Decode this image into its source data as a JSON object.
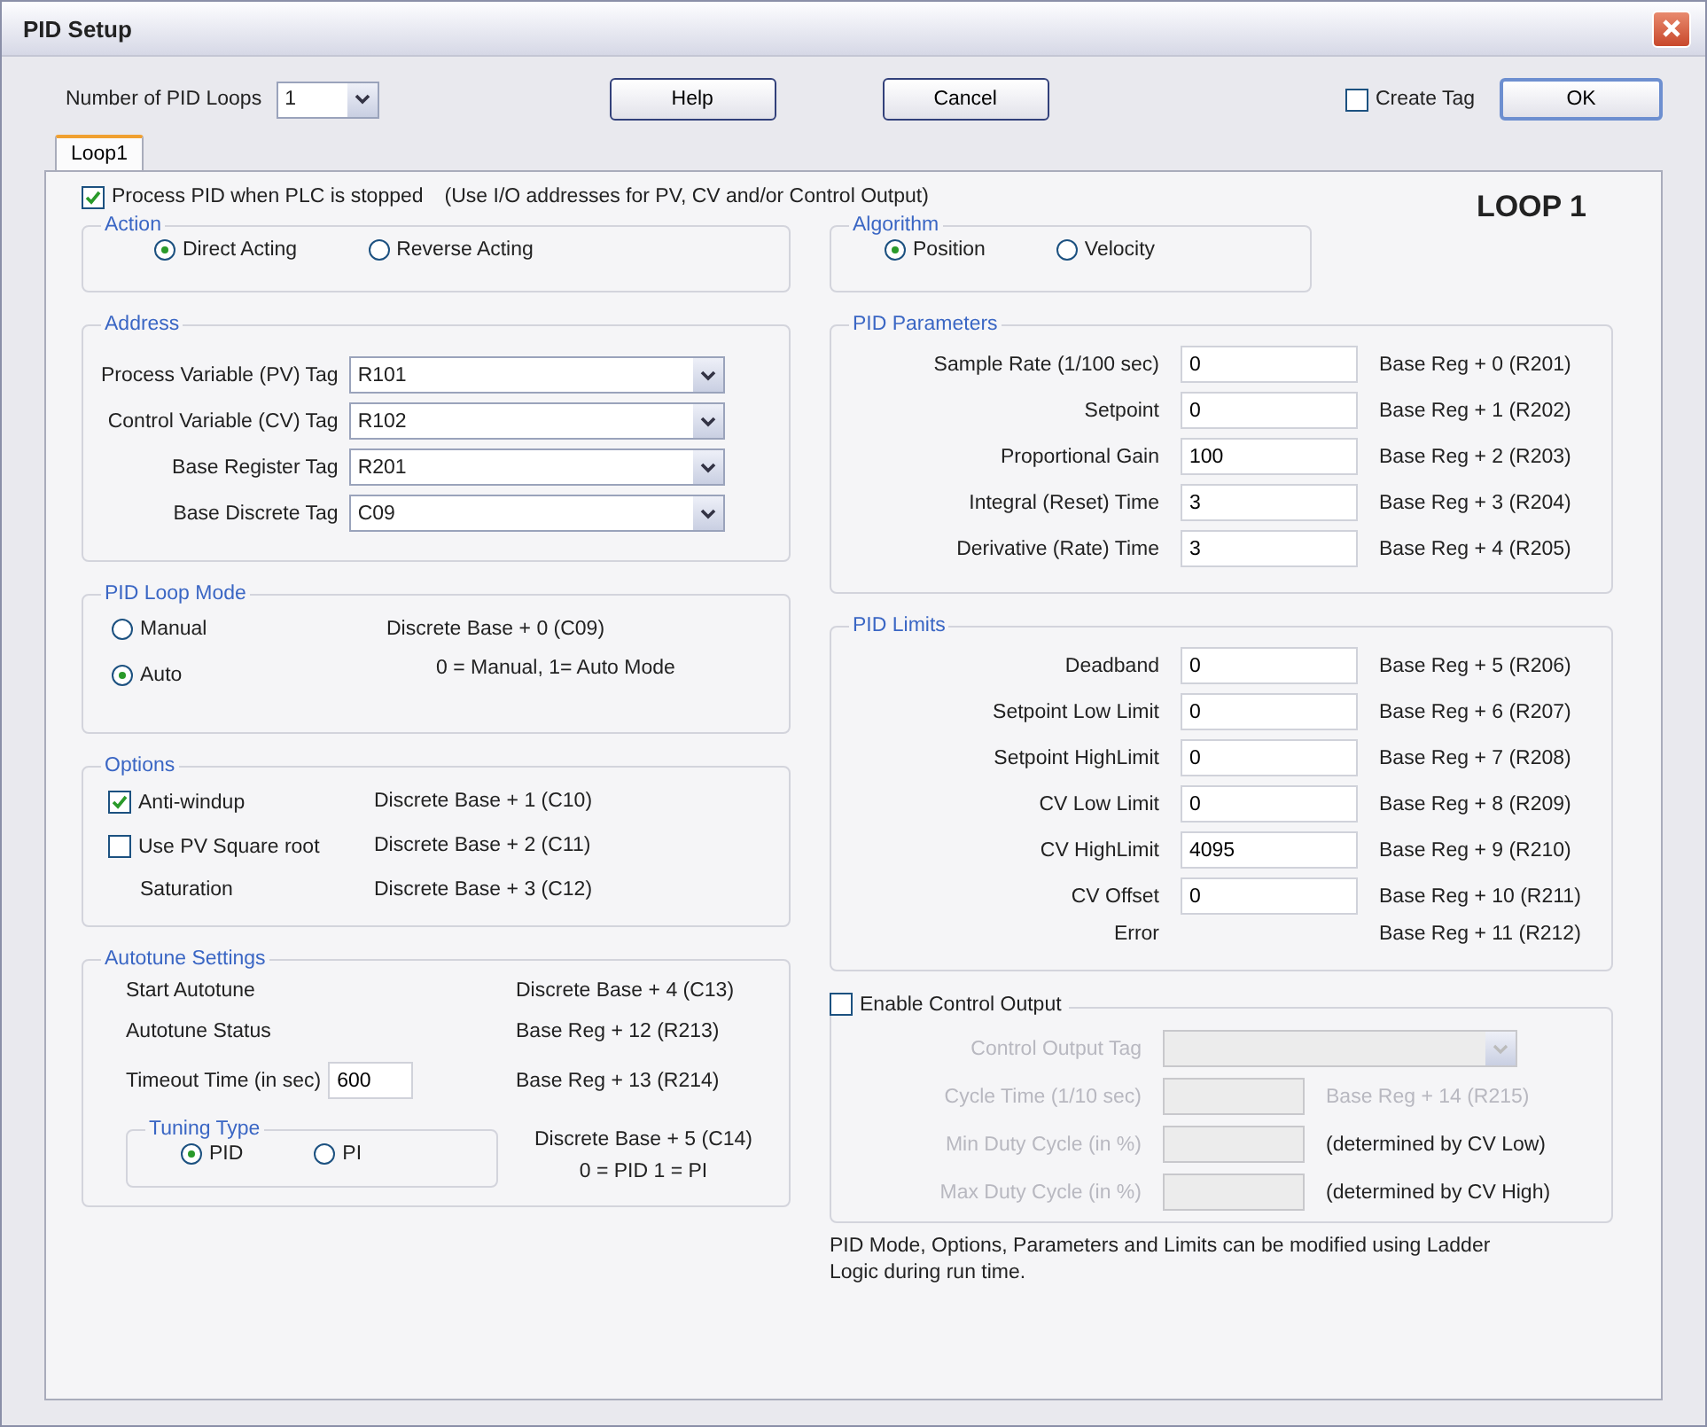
{
  "window": {
    "title": "PID Setup"
  },
  "header": {
    "loops_label": "Number of PID Loops",
    "loops_value": "1",
    "buttons": [
      "Help",
      "Cancel"
    ],
    "create_tag": {
      "label": "Create Tag",
      "checked": false
    },
    "ok": "OK"
  },
  "tabs": [
    {
      "label": "Loop1",
      "selected": true
    }
  ],
  "process_pid": {
    "label": "Process PID when PLC is stopped",
    "checked": true,
    "note": "(Use I/O addresses for PV, CV and/or Control Output)"
  },
  "loop_title": "LOOP 1",
  "action": {
    "title": "Action",
    "options": [
      {
        "label": "Direct Acting",
        "selected": true
      },
      {
        "label": "Reverse Acting",
        "selected": false
      }
    ]
  },
  "algorithm": {
    "title": "Algorithm",
    "options": [
      {
        "label": "Position",
        "selected": true
      },
      {
        "label": "Velocity",
        "selected": false
      }
    ]
  },
  "address": {
    "title": "Address",
    "rows": [
      {
        "label": "Process Variable (PV) Tag",
        "value": "R101"
      },
      {
        "label": "Control Variable (CV) Tag",
        "value": "R102"
      },
      {
        "label": "Base Register Tag",
        "value": "R201"
      },
      {
        "label": "Base Discrete Tag",
        "value": "C09"
      }
    ]
  },
  "loop_mode": {
    "title": "PID Loop Mode",
    "options": [
      {
        "label": "Manual",
        "selected": false
      },
      {
        "label": "Auto",
        "selected": true
      }
    ],
    "address": "Discrete Base + 0 (C09)",
    "legend": "0 = Manual,   1= Auto Mode"
  },
  "options": {
    "title": "Options",
    "rows": [
      {
        "kind": "checkbox",
        "label": "Anti-windup",
        "checked": true,
        "address": "Discrete Base + 1 (C10)"
      },
      {
        "kind": "checkbox",
        "label": "Use PV Square root",
        "checked": false,
        "address": "Discrete Base + 2 (C11)"
      },
      {
        "kind": "text",
        "label": "Saturation",
        "address": "Discrete Base + 3 (C12)"
      }
    ]
  },
  "autotune": {
    "title": "Autotune Settings",
    "rows": [
      {
        "kind": "text",
        "label": "Start Autotune",
        "address": "Discrete Base + 4 (C13)"
      },
      {
        "kind": "text",
        "label": "Autotune Status",
        "address": "Base Reg + 12 (R213)"
      },
      {
        "kind": "input",
        "label": "Timeout Time (in sec)",
        "value": "600",
        "address": "Base Reg + 13 (R214)"
      }
    ],
    "tuning": {
      "title": "Tuning Type",
      "options": [
        {
          "label": "PID",
          "selected": true
        },
        {
          "label": "PI",
          "selected": false
        }
      ]
    },
    "tuning_address": "Discrete Base + 5 (C14)",
    "tuning_legend": "0 = PID   1 = PI"
  },
  "pid_parameters": {
    "title": "PID Parameters",
    "rows": [
      {
        "kind": "input",
        "label": "Sample Rate (1/100 sec)",
        "value": "0",
        "address": "Base Reg + 0 (R201)"
      },
      {
        "kind": "input",
        "label": "Setpoint",
        "value": "0",
        "address": "Base Reg + 1 (R202)"
      },
      {
        "kind": "input",
        "label": "Proportional Gain",
        "value": "100",
        "address": "Base Reg + 2 (R203)"
      },
      {
        "kind": "input",
        "label": "Integral (Reset) Time",
        "value": "3",
        "address": "Base Reg + 3 (R204)"
      },
      {
        "kind": "input",
        "label": "Derivative (Rate) Time",
        "value": "3",
        "address": "Base Reg + 4 (R205)"
      }
    ]
  },
  "pid_limits": {
    "title": "PID Limits",
    "rows": [
      {
        "kind": "input",
        "label": "Deadband",
        "value": "0",
        "address": "Base Reg + 5 (R206)"
      },
      {
        "kind": "input",
        "label": "Setpoint Low Limit",
        "value": "0",
        "address": "Base Reg + 6 (R207)"
      },
      {
        "kind": "input",
        "label": "Setpoint HighLimit",
        "value": "0",
        "address": "Base Reg + 7 (R208)"
      },
      {
        "kind": "input",
        "label": "CV Low Limit",
        "value": "0",
        "address": "Base Reg + 8 (R209)"
      },
      {
        "kind": "input",
        "label": "CV HighLimit",
        "value": "4095",
        "address": "Base Reg + 9 (R210)"
      },
      {
        "kind": "input",
        "label": "CV Offset",
        "value": "0",
        "address": "Base Reg + 10 (R211)"
      },
      {
        "kind": "text",
        "label": "Error",
        "address": "Base Reg + 11 (R212)"
      }
    ]
  },
  "control_output": {
    "label": "Enable Control Output",
    "checked": false,
    "disabled": true,
    "tag_label": "Control Output Tag",
    "rows": [
      {
        "label": "Cycle Time (1/10 sec)",
        "note": "Base Reg + 14 (R215)",
        "note_disabled": true
      },
      {
        "label": "Min Duty Cycle (in %)",
        "note": "(determined by CV Low)",
        "note_disabled": false
      },
      {
        "label": "Max Duty Cycle (in %)",
        "note": "(determined by CV High)",
        "note_disabled": false
      }
    ]
  },
  "footer_note": "PID Mode, Options, Parameters and Limits can be modified using Ladder Logic during run time."
}
